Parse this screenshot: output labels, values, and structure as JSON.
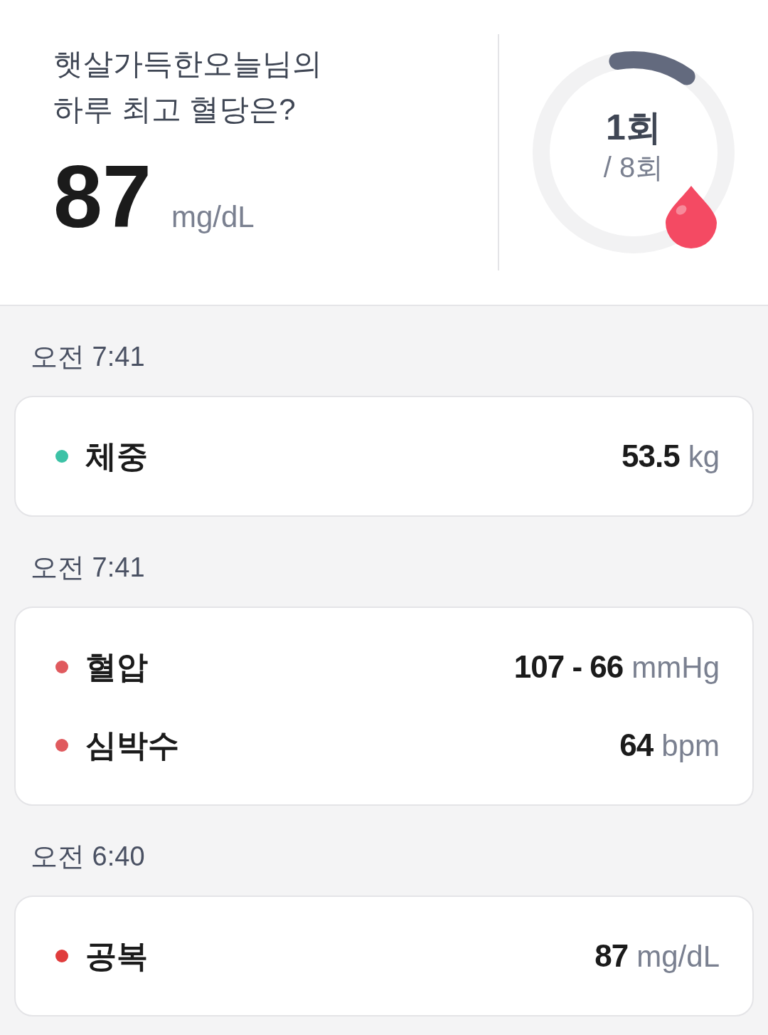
{
  "summary": {
    "title_line_1": "햇살가득한오늘님의",
    "title_line_2": "하루 최고 혈당은?",
    "value": "87",
    "unit": "mg/dL",
    "count": "1회",
    "total": "/ 8회",
    "level": 0.125
  },
  "groups": [
    {
      "time": "오전 7:41",
      "items": [
        {
          "name": "체중",
          "color": "#3cc2a6",
          "value": "53.5",
          "unit": "kg"
        }
      ]
    },
    {
      "time": "오전 7:41",
      "items": [
        {
          "name": "혈압",
          "color": "#e05a5e",
          "value": "107 - 66",
          "unit": "mmHg"
        },
        {
          "name": "심박수",
          "color": "#e05a5e",
          "value": "64",
          "unit": "bpm"
        }
      ]
    },
    {
      "time": "오전 6:40",
      "items": [
        {
          "name": "공복",
          "color": "#e03c3c",
          "value": "87",
          "unit": "mg/dL"
        }
      ]
    }
  ]
}
